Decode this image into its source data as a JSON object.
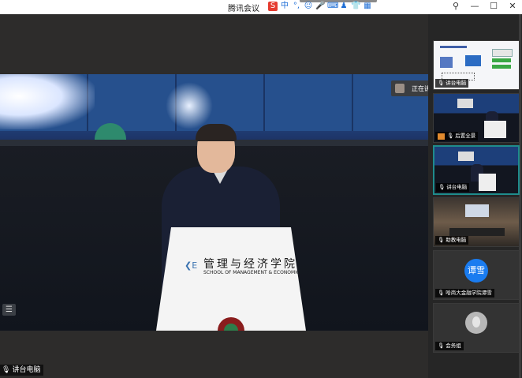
{
  "app": {
    "title": "腾讯会议"
  },
  "speaker_popup": {
    "text": "正在讲话: 讲台电脑"
  },
  "bottom_name": {
    "label": "讲台电脑"
  },
  "podium": {
    "name": "管理与经济学院",
    "sub": "SCHOOL OF MANAGEMENT & ECONOMICS"
  },
  "tiles": [
    {
      "label": "讲台电脑",
      "type": "slide"
    },
    {
      "label": "后置全景",
      "type": "stage"
    },
    {
      "label": "讲台电脑",
      "type": "stage"
    },
    {
      "label": "助教电脑",
      "type": "room"
    },
    {
      "label": "哈商大金融学院谭雪",
      "type": "avatar",
      "avatar_text": "谭雪"
    },
    {
      "label": "会务组",
      "type": "photo"
    }
  ]
}
